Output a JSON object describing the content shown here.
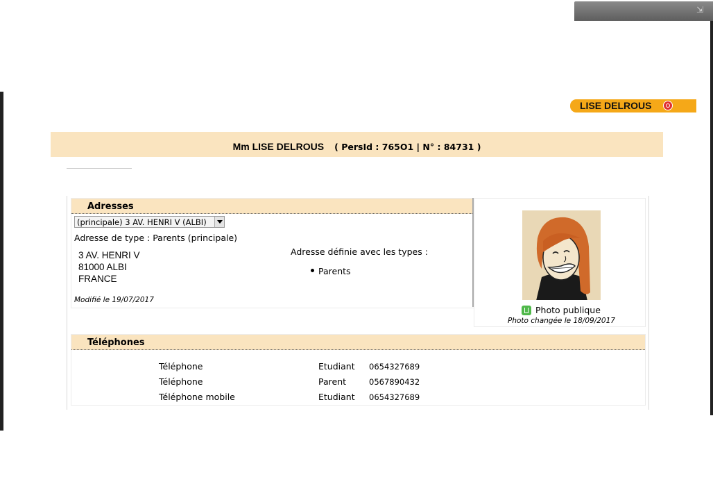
{
  "user": {
    "name": "LISE DELROUS"
  },
  "header": {
    "name": "Mm LISE DELROUS",
    "ids": "( PersId : 765O1 | N° : 84731 )"
  },
  "addresses": {
    "title": "Adresses",
    "selected_option": "(principale)  3 AV. HENRI V (ALBI)",
    "type_label": "Adresse de type : Parents (principale)",
    "lines": [
      "3 AV. HENRI V",
      "81000 ALBI",
      "FRANCE"
    ],
    "modified": "Modifié le 19/07/2017",
    "types_heading": "Adresse définie avec les types :",
    "types": [
      "Parents"
    ]
  },
  "photo": {
    "public_label": "Photo publique",
    "changed": "Photo changée le 18/09/2017"
  },
  "phones": {
    "title": "Téléphones",
    "rows": [
      {
        "type": "Téléphone",
        "owner": "Etudiant",
        "number": "0654327689"
      },
      {
        "type": "Téléphone",
        "owner": "Parent",
        "number": "0567890432"
      },
      {
        "type": "Téléphone mobile",
        "owner": "Etudiant",
        "number": "0654327689"
      }
    ]
  },
  "colors": {
    "band": "#fae4bf",
    "badge": "#f5a818"
  },
  "icons": {
    "logout": "logout-icon",
    "expand": "expand-arrow-icon",
    "public_photo": "thumbs-up-icon"
  }
}
